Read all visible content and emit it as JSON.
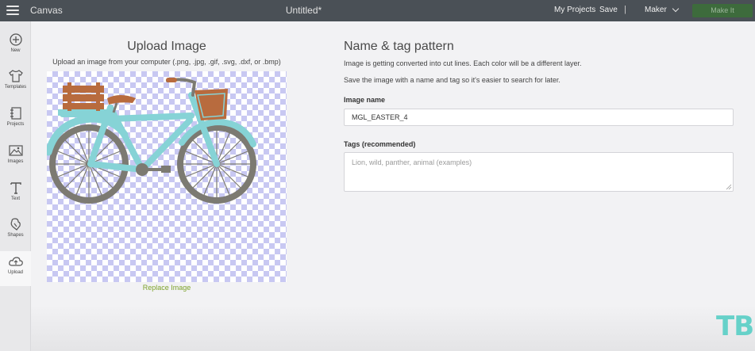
{
  "header": {
    "app_name": "Canvas",
    "document_title": "Untitled*",
    "my_projects": "My Projects",
    "save": "Save",
    "separator": "|",
    "machine": "Maker",
    "make_button": "Make It"
  },
  "sidebar": {
    "items": [
      {
        "label": "New",
        "icon": "plus-circle-icon"
      },
      {
        "label": "Templates",
        "icon": "shirt-icon"
      },
      {
        "label": "Projects",
        "icon": "projects-icon"
      },
      {
        "label": "Images",
        "icon": "image-icon"
      },
      {
        "label": "Text",
        "icon": "text-icon"
      },
      {
        "label": "Shapes",
        "icon": "shapes-icon"
      },
      {
        "label": "Upload",
        "icon": "cloud-upload-icon"
      }
    ],
    "active": "Upload"
  },
  "upload": {
    "title": "Upload Image",
    "subtitle": "Upload an image from your computer (.png, .jpg, .gif, .svg, .dxf, or .bmp)",
    "replace_link": "Replace Image"
  },
  "form": {
    "title": "Name & tag pattern",
    "info_1": "Image is getting converted into cut lines. Each color will be a different layer.",
    "info_2": "Save the image with a name and tag so it's easier to search for later.",
    "name_label": "Image name",
    "name_value": "MGL_EASTER_4",
    "tags_label": "Tags (recommended)",
    "tags_placeholder": "Lion, wild, panther, animal (examples)"
  },
  "watermark": "TB",
  "colors": {
    "topbar": "#4a5056",
    "bike_frame": "#86d3d6",
    "bike_tire": "#7c7a72",
    "basket": "#b86b3e",
    "link_green": "#7ea32c",
    "watermark": "#66d1c9"
  }
}
